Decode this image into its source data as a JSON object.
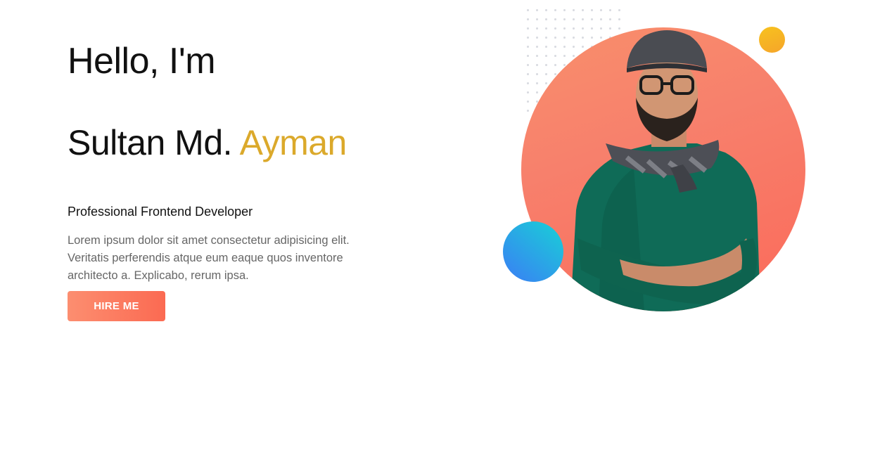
{
  "hero": {
    "greeting": "Hello, I'm",
    "name_first": "Sultan Md.",
    "name_accent": "Ayman",
    "role": "Professional Frontend Developer",
    "bio": "Lorem ipsum dolor sit amet consectetur adipisicing elit. Veritatis perferendis atque eum eaque quos inventore architecto a. Explicabo, rerum ipsa.",
    "cta_label": "HIRE ME"
  },
  "colors": {
    "accent": "#dba92b",
    "button_start": "#fc8e70",
    "button_end": "#fb6a52",
    "circle_main": "#f98a6a",
    "circle_blue": "#2aa7e6",
    "circle_yellow": "#f7b824"
  },
  "art": {
    "portrait_icon": "person-portrait",
    "dots_icon": "dot-grid-pattern"
  }
}
